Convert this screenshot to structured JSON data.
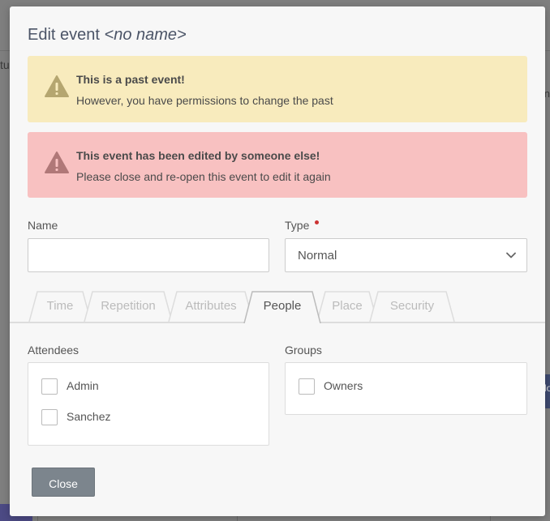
{
  "background": {
    "left_fragment": "tus",
    "right_fragment": "n",
    "right_button_fragment": "lo"
  },
  "modal": {
    "title_prefix": "Edit event",
    "title_name": "<no name>",
    "alerts": [
      {
        "type": "warning",
        "title": "This is a past event!",
        "message": "However, you have permissions to change the past",
        "icon": "warning-triangle-icon",
        "color": "#f8ebbd"
      },
      {
        "type": "error",
        "title": "This event has been edited by someone else!",
        "message": "Please close and re-open this event to edit it again",
        "icon": "warning-triangle-icon",
        "color": "#f8c1c1"
      }
    ],
    "name_field": {
      "label": "Name",
      "value": ""
    },
    "type_field": {
      "label": "Type",
      "value": "Normal",
      "required": true
    },
    "tabs": [
      {
        "label": "Time",
        "active": false
      },
      {
        "label": "Repetition",
        "active": false
      },
      {
        "label": "Attributes",
        "active": false
      },
      {
        "label": "People",
        "active": true
      },
      {
        "label": "Place",
        "active": false
      },
      {
        "label": "Security",
        "active": false
      }
    ],
    "attendees": {
      "label": "Attendees",
      "items": [
        {
          "label": "Admin",
          "checked": false
        },
        {
          "label": "Sanchez",
          "checked": false
        }
      ]
    },
    "groups": {
      "label": "Groups",
      "items": [
        {
          "label": "Owners",
          "checked": false
        }
      ]
    },
    "close_label": "Close"
  }
}
